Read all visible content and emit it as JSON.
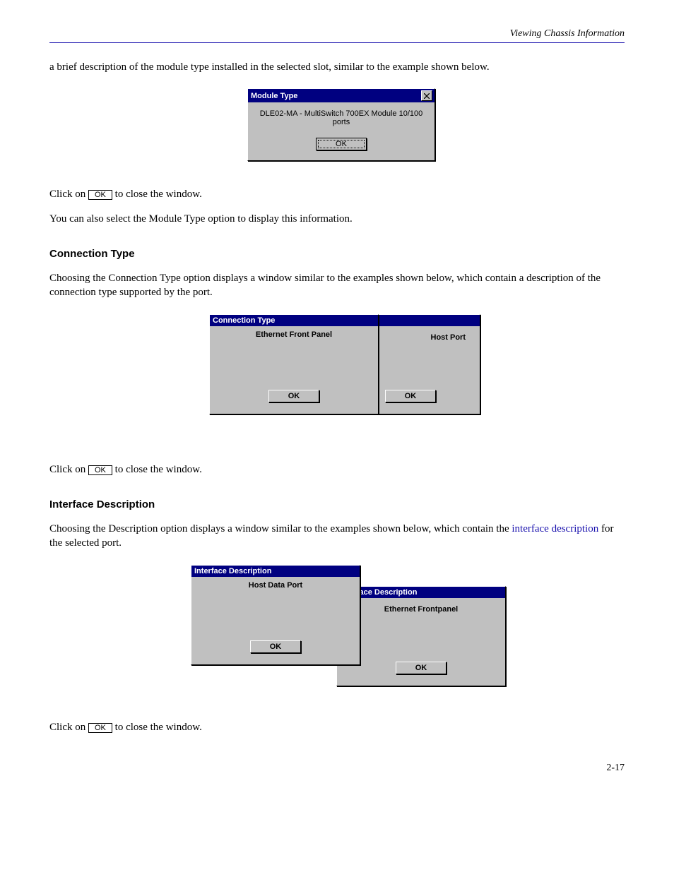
{
  "header": {
    "section_title": "Viewing Chassis Information"
  },
  "para1": "a brief description of the module type installed in the selected slot, similar to the example shown below.",
  "dialog_module": {
    "title": "Module Type",
    "message": "DLE02-MA - MultiSwitch 700EX Module 10/100 ports",
    "ok": "OK"
  },
  "para2_1": "Click on ",
  "para2_ok": "OK",
  "para2_2": " to close the window.",
  "para3": "You can also select the Module Type option to display this information.",
  "heading_connection": "Connection Type",
  "para_connection": "Choosing the Connection Type option displays a window similar to the examples shown below, which contain a description of the connection type supported by the port.",
  "dialog_conn_back": {
    "title": "Connection Type",
    "message": "Host Port",
    "ok": "OK"
  },
  "dialog_conn_front": {
    "title": "Connection Type",
    "message": "Ethernet Front Panel",
    "ok": "OK"
  },
  "heading_iface": "Interface Description",
  "para_iface_1": "Choosing the Description option displays a window similar to the examples shown below, which contain the ",
  "para_iface_link": "interface description",
  "para_iface_2": " for the selected port.",
  "dialog_iface_front": {
    "title": "Interface Description",
    "message": "Host Data Port",
    "ok": "OK"
  },
  "dialog_iface_back": {
    "title": "Interface Description",
    "message": "Ethernet Frontpanel",
    "ok": "OK"
  },
  "page_number": "2-17"
}
